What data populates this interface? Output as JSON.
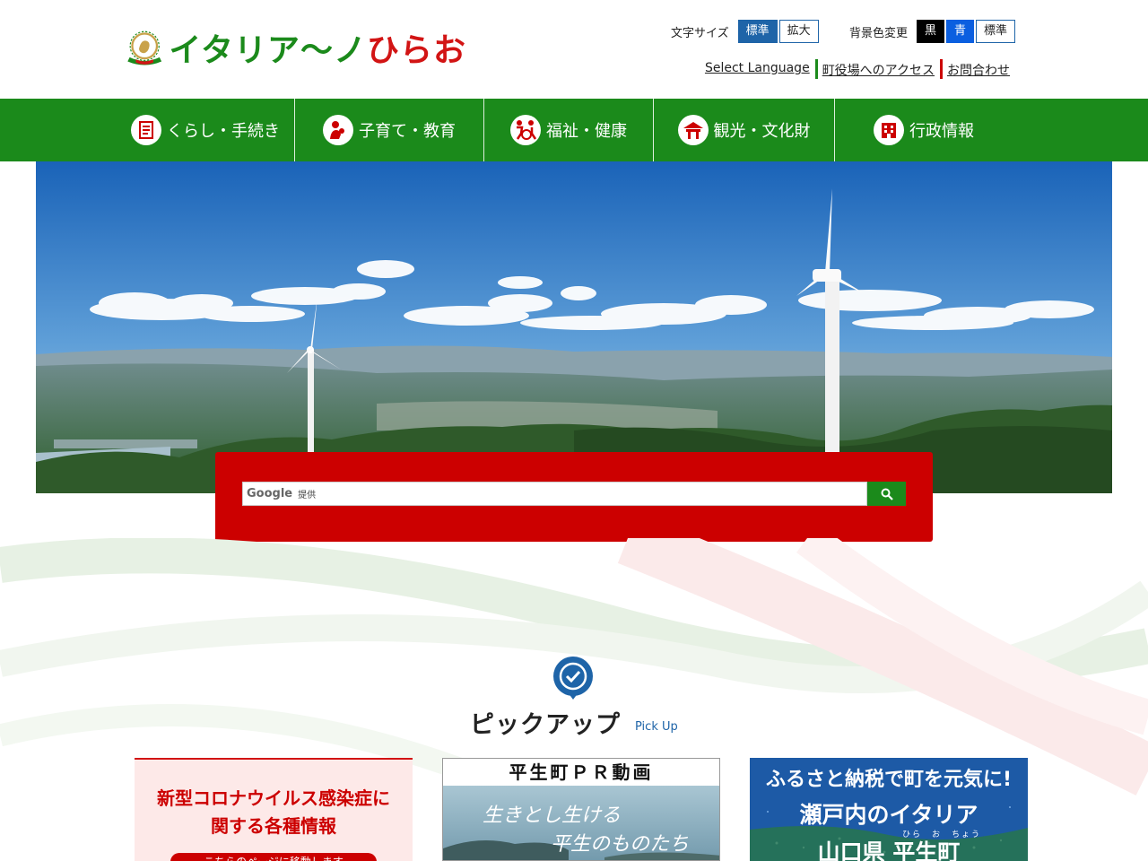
{
  "header": {
    "logo_badge": "ITALIANO HIRAO",
    "logo_text_a": "イタリア〜ノ",
    "logo_text_b": "ひらお",
    "font_size_label": "文字サイズ",
    "font_size_standard": "標準",
    "font_size_large": "拡大",
    "bg_color_label": "背景色変更",
    "bg_black": "黒",
    "bg_blue": "青",
    "bg_standard": "標準",
    "links": [
      "Select Language",
      "町役場へのアクセス",
      "お問合わせ"
    ]
  },
  "nav": {
    "items": [
      {
        "label": "くらし・手続き",
        "icon": "checklist-icon"
      },
      {
        "label": "子育て・教育",
        "icon": "parent-child-icon"
      },
      {
        "label": "福祉・健康",
        "icon": "accessibility-icon"
      },
      {
        "label": "観光・文化財",
        "icon": "temple-icon"
      },
      {
        "label": "行政情報",
        "icon": "building-icon"
      }
    ]
  },
  "hero": {
    "image_alt": "wind-turbines-over-mountains"
  },
  "search": {
    "brand": "Google",
    "provided": "提供"
  },
  "pickup": {
    "title": "ピックアップ",
    "subtitle": "Pick Up",
    "cards": [
      {
        "line1": "新型コロナウイルス感染症に",
        "line2": "関する各種情報",
        "banner": "こちらのページに移動します"
      },
      {
        "title": "平生町ＰＲ動画",
        "caption1": "生きとし生ける",
        "caption2": "平生のものたち"
      },
      {
        "line1": "ふるさと納税で町を元気に!",
        "line2": "瀬戸内のイタリア",
        "line3": "山口県 平生町",
        "ruby": "ひら　お　ちょう"
      }
    ]
  },
  "colors": {
    "green": "#1b8a1b",
    "red": "#cc0000",
    "blue": "#1e64a8"
  }
}
